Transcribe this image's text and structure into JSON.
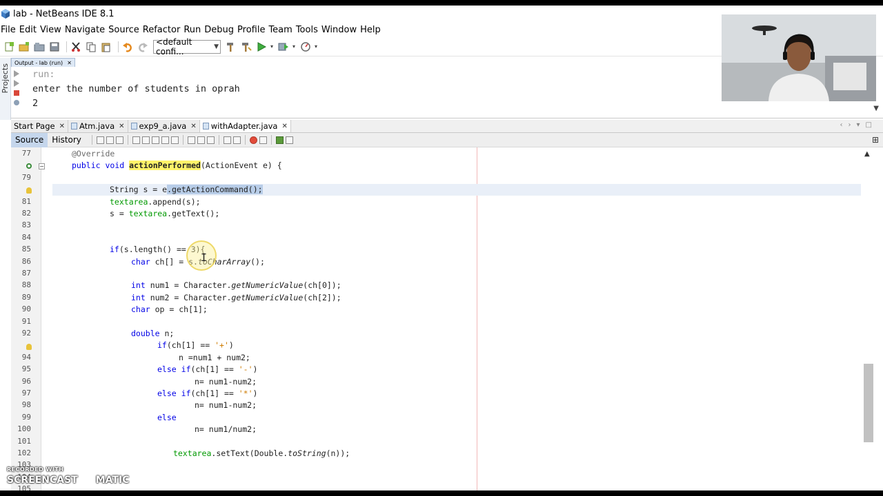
{
  "window": {
    "title": "lab - NetBeans IDE 8.1"
  },
  "menu": [
    "File",
    "Edit",
    "View",
    "Navigate",
    "Source",
    "Refactor",
    "Run",
    "Debug",
    "Profile",
    "Team",
    "Tools",
    "Window",
    "Help"
  ],
  "toolbar": {
    "config_value": "<default confi..."
  },
  "side_panel": {
    "label": "Projects"
  },
  "output": {
    "tab_label": "Output - lab (run)",
    "lines": [
      "run:",
      "enter the number of students in oprah",
      "2"
    ]
  },
  "editor_tabs": [
    {
      "label": "Start Page",
      "active": false
    },
    {
      "label": "Atm.java",
      "active": false
    },
    {
      "label": "exp9_a.java",
      "active": false
    },
    {
      "label": "withAdapter.java",
      "active": true
    }
  ],
  "source_bar": {
    "source_label": "Source",
    "history_label": "History"
  },
  "code_lines": [
    {
      "no": "77",
      "text": "@Override"
    },
    {
      "no": "",
      "text": "public void actionPerformed(ActionEvent e) {"
    },
    {
      "no": "79",
      "text": ""
    },
    {
      "no": "",
      "text": "String s = e.getActionCommand();"
    },
    {
      "no": "81",
      "text": "textarea.append(s);"
    },
    {
      "no": "82",
      "text": "s = textarea.getText();"
    },
    {
      "no": "83",
      "text": ""
    },
    {
      "no": "84",
      "text": ""
    },
    {
      "no": "85",
      "text": "if(s.length() == 3){"
    },
    {
      "no": "86",
      "text": "char ch[] = s.toCharArray();"
    },
    {
      "no": "87",
      "text": ""
    },
    {
      "no": "88",
      "text": "int num1 = Character.getNumericValue(ch[0]);"
    },
    {
      "no": "89",
      "text": "int num2 = Character.getNumericValue(ch[2]);"
    },
    {
      "no": "90",
      "text": "char op = ch[1];"
    },
    {
      "no": "91",
      "text": ""
    },
    {
      "no": "92",
      "text": "double n;"
    },
    {
      "no": "",
      "text": "if(ch[1] == '+')"
    },
    {
      "no": "94",
      "text": "n =num1 + num2;"
    },
    {
      "no": "95",
      "text": "else if(ch[1] == '-')"
    },
    {
      "no": "96",
      "text": "n= num1-num2;"
    },
    {
      "no": "97",
      "text": "else if(ch[1] == '*')"
    },
    {
      "no": "98",
      "text": "n= num1-num2;"
    },
    {
      "no": "99",
      "text": "else"
    },
    {
      "no": "100",
      "text": "n= num1/num2;"
    },
    {
      "no": "101",
      "text": ""
    },
    {
      "no": "102",
      "text": "textarea.setText(Double.toString(n));"
    },
    {
      "no": "103",
      "text": ""
    },
    {
      "no": "104",
      "text": ""
    },
    {
      "no": "105",
      "text": ""
    }
  ],
  "watermark": {
    "line1": "RECORDED WITH",
    "line2a": "SCREENCAST",
    "line2b": "MATIC"
  },
  "colors": {
    "keyword": "#0000e6",
    "field": "#009900",
    "highlight": "#fff36a",
    "selection": "#b8cde8"
  }
}
